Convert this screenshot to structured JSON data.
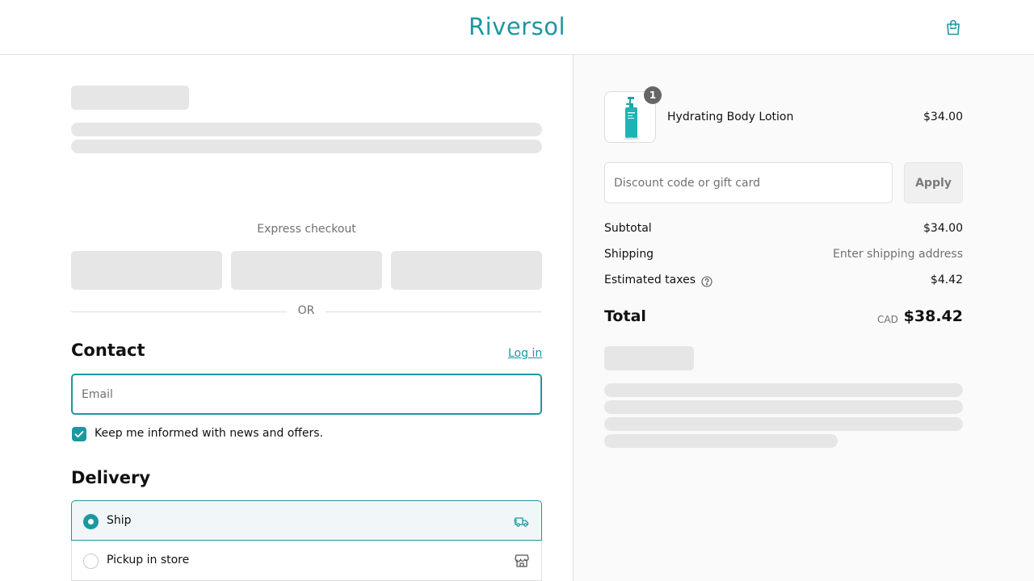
{
  "brand": {
    "name": "Riversol",
    "accent": "#1b98a0"
  },
  "header": {
    "cart_icon": "shopping-bag-icon"
  },
  "express": {
    "title": "Express checkout",
    "divider": "OR"
  },
  "contact": {
    "heading": "Contact",
    "login_label": "Log in",
    "email_placeholder": "Email",
    "email_value": "",
    "newsletter_label": "Keep me informed with news and offers.",
    "newsletter_checked": true
  },
  "delivery": {
    "heading": "Delivery",
    "options": [
      {
        "label": "Ship",
        "selected": true,
        "icon": "truck-icon"
      },
      {
        "label": "Pickup in store",
        "selected": false,
        "icon": "store-icon"
      }
    ]
  },
  "summary": {
    "items": [
      {
        "name": "Hydrating Body Lotion",
        "price": "$34.00",
        "quantity": "1"
      }
    ],
    "discount_placeholder": "Discount code or gift card",
    "apply_label": "Apply",
    "subtotal_label": "Subtotal",
    "subtotal_value": "$34.00",
    "shipping_label": "Shipping",
    "shipping_value": "Enter shipping address",
    "taxes_label": "Estimated taxes",
    "taxes_value": "$4.42",
    "total_label": "Total",
    "currency": "CAD",
    "total_value": "$38.42"
  }
}
